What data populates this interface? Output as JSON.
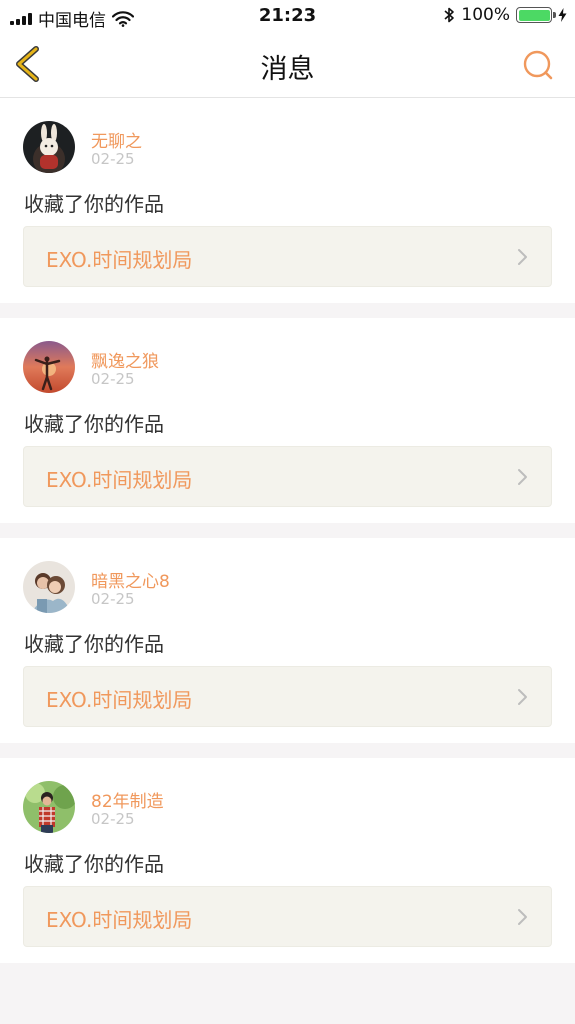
{
  "status_bar": {
    "carrier": "中国电信",
    "time": "21:23",
    "battery": "100%",
    "battery_level": 1.0
  },
  "nav": {
    "title": "消息",
    "back_icon": "chevron-left-icon",
    "search_icon": "search-icon"
  },
  "colors": {
    "accent": "#f0985c",
    "back_yellow": "#e6b418",
    "card_link_bg": "#f4f3ed"
  },
  "messages": [
    {
      "username": "无聊之",
      "date": "02-25",
      "action": "收藏了你的作品",
      "work_title": "EXO.时间规划局"
    },
    {
      "username": "飘逸之狼",
      "date": "02-25",
      "action": "收藏了你的作品",
      "work_title": "EXO.时间规划局"
    },
    {
      "username": "暗黑之心8",
      "date": "02-25",
      "action": "收藏了你的作品",
      "work_title": "EXO.时间规划局"
    },
    {
      "username": "82年制造",
      "date": "02-25",
      "action": "收藏了你的作品",
      "work_title": "EXO.时间规划局"
    }
  ]
}
